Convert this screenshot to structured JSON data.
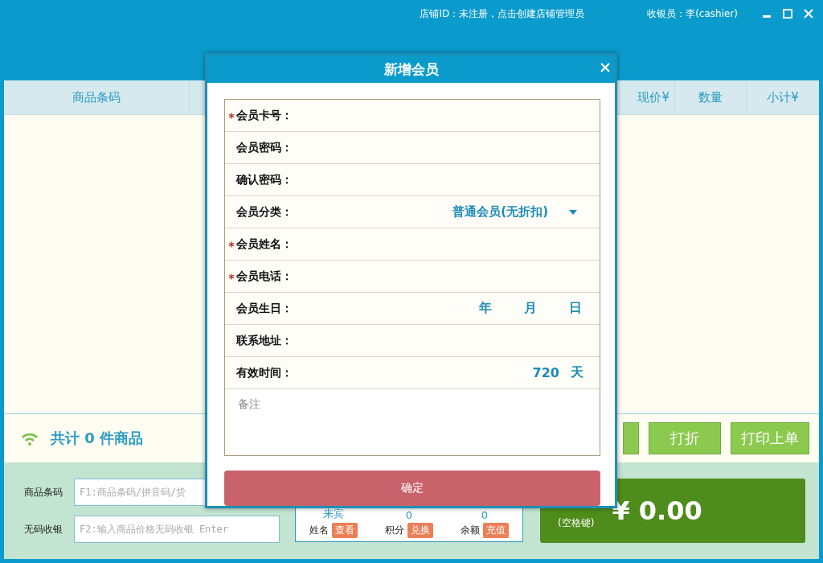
{
  "title_bar": {
    "store_id": "店铺ID：未注册，点击创建店铺管理员",
    "cashier": "收银员：李(cashier)"
  },
  "table": {
    "columns": [
      "商品条码",
      "现价¥",
      "数量",
      "小计¥"
    ]
  },
  "summary": {
    "prefix": "共计",
    "count": "0",
    "suffix": "件商品"
  },
  "actions": [
    "打折",
    "打印上单"
  ],
  "inputs": [
    {
      "label": "商品条码",
      "placeholder": "F1:商品条码/拼音码/货"
    },
    {
      "label": "无码收银",
      "placeholder": "F2:输入商品价格无码收银 Enter"
    }
  ],
  "member": [
    {
      "value": "来宾",
      "label": "姓名",
      "action": "查看"
    },
    {
      "value": "0",
      "label": "积分",
      "action": "兑换"
    },
    {
      "value": "0",
      "label": "余额",
      "action": "充值"
    }
  ],
  "checkout": {
    "hint": "(空格键)",
    "amount": "¥ 0.00"
  },
  "dialog": {
    "title": "新增会员",
    "fields": [
      {
        "label": "会员卡号：",
        "required": true,
        "kind": "text"
      },
      {
        "label": "会员密码：",
        "required": false,
        "kind": "text"
      },
      {
        "label": "确认密码：",
        "required": false,
        "kind": "text"
      },
      {
        "label": "会员分类：",
        "required": false,
        "kind": "select",
        "value": "普通会员(无折扣)"
      },
      {
        "label": "会员姓名：",
        "required": true,
        "kind": "text"
      },
      {
        "label": "会员电话：",
        "required": true,
        "kind": "text"
      },
      {
        "label": "会员生日：",
        "required": false,
        "kind": "date",
        "parts": [
          "年",
          "月",
          "日"
        ]
      },
      {
        "label": "联系地址：",
        "required": false,
        "kind": "text"
      },
      {
        "label": "有效时间：",
        "required": false,
        "kind": "days",
        "value": "720",
        "unit": "天"
      }
    ],
    "notes_placeholder": "备注",
    "confirm": "确定"
  }
}
